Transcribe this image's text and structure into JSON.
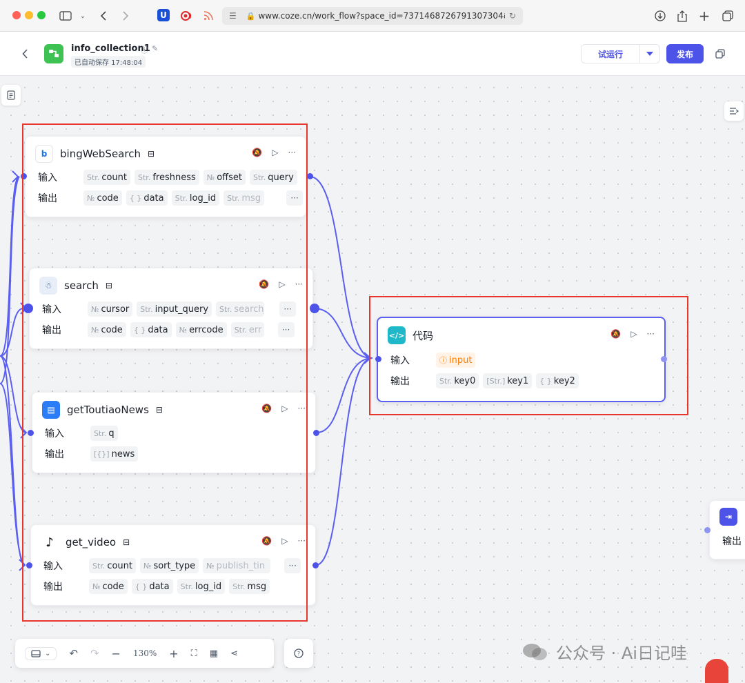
{
  "browser": {
    "url": "www.coze.cn/work_flow?space_id=7371468726791307304&wor"
  },
  "header": {
    "title": "info_collection1",
    "autosave": "已自动保存 17:48:04",
    "test_run": "试运行",
    "publish": "发布"
  },
  "labels": {
    "input": "输入",
    "output": "输出"
  },
  "nodes": {
    "bing": {
      "name": "bingWebSearch",
      "inputs": [
        {
          "t": "Str.",
          "name": "count"
        },
        {
          "t": "Str.",
          "name": "freshness"
        },
        {
          "t": "№",
          "name": "offset"
        },
        {
          "t": "Str.",
          "name": "query"
        }
      ],
      "outputs": [
        {
          "t": "№",
          "name": "code"
        },
        {
          "t": "{ }",
          "name": "data"
        },
        {
          "t": "Str.",
          "name": "log_id"
        },
        {
          "t": "Str.",
          "name": "msg"
        }
      ]
    },
    "search": {
      "name": "search",
      "inputs": [
        {
          "t": "№",
          "name": "cursor"
        },
        {
          "t": "Str.",
          "name": "input_query"
        },
        {
          "t": "Str.",
          "name": "search_"
        }
      ],
      "outputs": [
        {
          "t": "№",
          "name": "code"
        },
        {
          "t": "{ }",
          "name": "data"
        },
        {
          "t": "№",
          "name": "errcode"
        },
        {
          "t": "Str.",
          "name": "err"
        }
      ]
    },
    "toutiao": {
      "name": "getToutiaoNews",
      "inputs": [
        {
          "t": "Str.",
          "name": "q"
        }
      ],
      "outputs": [
        {
          "t": "[{}]",
          "name": "news"
        }
      ]
    },
    "video": {
      "name": "get_video",
      "inputs": [
        {
          "t": "Str.",
          "name": "count"
        },
        {
          "t": "№",
          "name": "sort_type"
        },
        {
          "t": "№",
          "name": "publish_tin"
        }
      ],
      "outputs": [
        {
          "t": "№",
          "name": "code"
        },
        {
          "t": "{ }",
          "name": "data"
        },
        {
          "t": "Str.",
          "name": "log_id"
        },
        {
          "t": "Str.",
          "name": "msg"
        }
      ]
    },
    "code": {
      "name": "代码",
      "inputs": [
        {
          "t": "ⓘ",
          "name": "input"
        }
      ],
      "outputs": [
        {
          "t": "Str.",
          "name": "key0"
        },
        {
          "t": "[Str.]",
          "name": "key1"
        },
        {
          "t": "{ }",
          "name": "key2"
        }
      ]
    },
    "end": {
      "output": "输出"
    }
  },
  "toolbar": {
    "zoom": "130%"
  },
  "watermark": "公众号 · Ai日记哇",
  "colors": {
    "accent": "#4d53e8",
    "highlight": "#e8352d",
    "brand_green": "#3ec254"
  }
}
